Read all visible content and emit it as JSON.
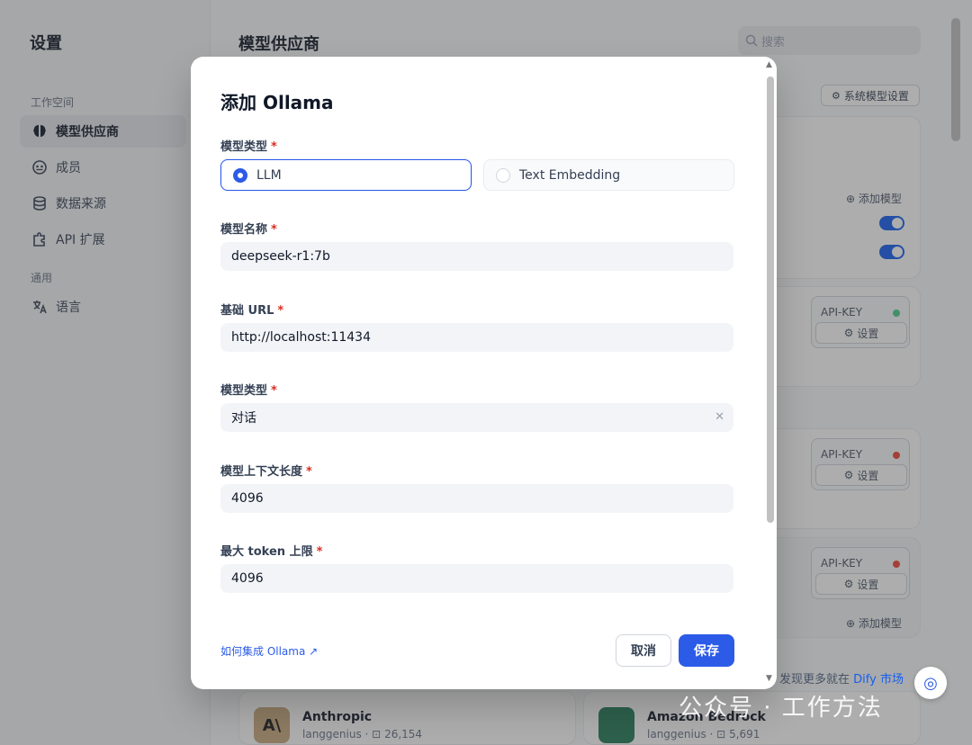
{
  "sidebar": {
    "title": "设置",
    "workspace_label": "工作空间",
    "items": [
      {
        "label": "模型供应商",
        "icon": "brain-icon"
      },
      {
        "label": "成员",
        "icon": "members-icon"
      },
      {
        "label": "数据来源",
        "icon": "database-icon"
      },
      {
        "label": "API 扩展",
        "icon": "puzzle-icon"
      }
    ],
    "general_label": "通用",
    "language": {
      "label": "语言",
      "icon": "translate-icon"
    }
  },
  "main": {
    "title": "模型供应商",
    "search_placeholder": "搜索",
    "system_model_settings": "系统模型设置",
    "add_model": "添加模型",
    "api_key": "API-KEY",
    "settings": "设置",
    "discover_text": "发现更多就在",
    "discover_link": "Dify 市场",
    "bottom_cards": [
      {
        "title": "Anthropic",
        "author": "langgenius",
        "count": "26,154"
      },
      {
        "title": "Amazon Bedrock",
        "author": "langgenius",
        "count": "5,691"
      }
    ]
  },
  "modal": {
    "title": "添加 Ollama",
    "model_type_label": "模型类型",
    "model_type_options": [
      "LLM",
      "Text Embedding"
    ],
    "model_type_selected": "LLM",
    "model_name_label": "模型名称",
    "model_name_value": "deepseek-r1:7b",
    "base_url_label": "基础 URL",
    "base_url_value": "http://localhost:11434",
    "model_kind_label": "模型类型",
    "model_kind_value": "对话",
    "context_length_label": "模型上下文长度",
    "context_length_value": "4096",
    "max_token_label": "最大 token 上限",
    "max_token_value": "4096",
    "help_link": "如何集成 Ollama",
    "cancel": "取消",
    "save": "保存",
    "required_mark": "*"
  },
  "watermark": "公众号 · 工作方法",
  "colors": {
    "primary": "#2c5be8",
    "status_green": "#47cd89",
    "status_red": "#f04438"
  }
}
